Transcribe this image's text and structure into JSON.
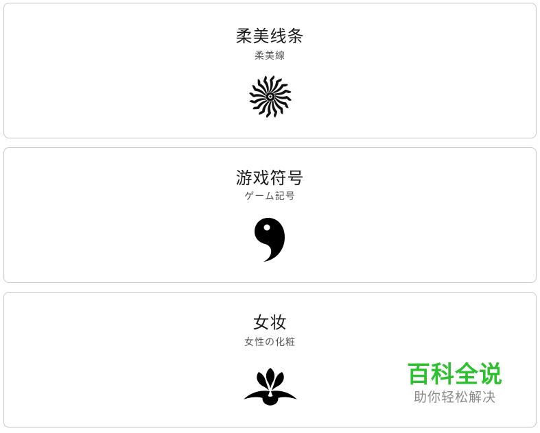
{
  "cards": [
    {
      "title": "柔美线条",
      "subtitle": "柔美線",
      "icon": "sunburst-flower-icon"
    },
    {
      "title": "游戏符号",
      "subtitle": "ゲーム記号",
      "icon": "comma-symbol-icon"
    },
    {
      "title": "女妆",
      "subtitle": "女性の化粧",
      "icon": "iris-flower-icon"
    }
  ],
  "watermark": {
    "main": "百科全说",
    "sub": "助你轻松解决",
    "main_color": "#2ec02e",
    "sub_color": "#8a8a8a"
  }
}
